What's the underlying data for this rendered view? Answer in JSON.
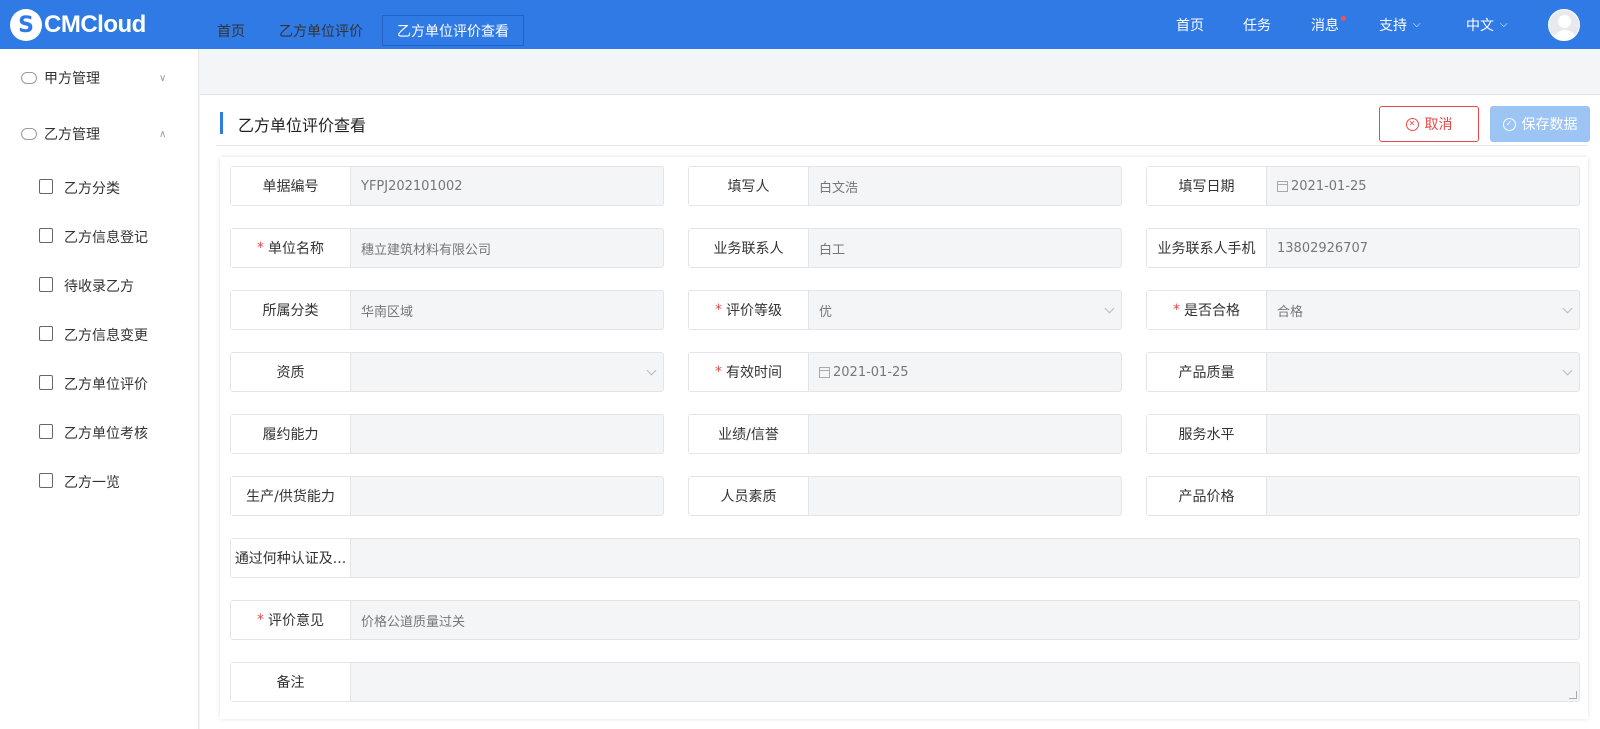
{
  "app": {
    "logo_mark": "S",
    "logo_text": "CMCloud"
  },
  "topnav": {
    "home": "首页",
    "tasks": "任务",
    "messages": "消息",
    "support": "支持",
    "language": "中文"
  },
  "sidebar": {
    "groups": [
      {
        "label": "甲方管理",
        "expanded": false
      },
      {
        "label": "乙方管理",
        "expanded": true
      }
    ],
    "items": [
      {
        "label": "乙方分类"
      },
      {
        "label": "乙方信息登记"
      },
      {
        "label": "待收录乙方"
      },
      {
        "label": "乙方信息变更"
      },
      {
        "label": "乙方单位评价"
      },
      {
        "label": "乙方单位考核"
      },
      {
        "label": "乙方一览"
      }
    ]
  },
  "tabs": [
    {
      "label": "首页",
      "active": false
    },
    {
      "label": "乙方单位评价",
      "active": false
    },
    {
      "label": "乙方单位评价查看",
      "active": true
    }
  ],
  "page": {
    "title": "乙方单位评价查看",
    "cancel_label": "取消",
    "save_label": "保存数据"
  },
  "form": {
    "doc_no": {
      "label": "单据编号",
      "value": "YFPJ202101002"
    },
    "filler": {
      "label": "填写人",
      "value": "白文浩"
    },
    "fill_date": {
      "label": "填写日期",
      "value": "2021-01-25"
    },
    "unit_name": {
      "label": "单位名称",
      "value": "穗立建筑材料有限公司",
      "required": true
    },
    "contact": {
      "label": "业务联系人",
      "value": "白工"
    },
    "contact_phone": {
      "label": "业务联系人手机",
      "value": "13802926707"
    },
    "category": {
      "label": "所属分类",
      "value": "华南区域"
    },
    "rating_level": {
      "label": "评价等级",
      "value": "优",
      "required": true
    },
    "qualified": {
      "label": "是否合格",
      "value": "合格",
      "required": true
    },
    "qualification": {
      "label": "资质",
      "value": ""
    },
    "valid_time": {
      "label": "有效时间",
      "value": "2021-01-25",
      "required": true
    },
    "product_quality": {
      "label": "产品质量",
      "value": ""
    },
    "performance": {
      "label": "履约能力",
      "value": ""
    },
    "credit": {
      "label": "业绩/信誉",
      "value": ""
    },
    "service": {
      "label": "服务水平",
      "value": ""
    },
    "supply": {
      "label": "生产/供货能力",
      "value": ""
    },
    "staff": {
      "label": "人员素质",
      "value": ""
    },
    "price": {
      "label": "产品价格",
      "value": ""
    },
    "certification": {
      "label": "通过何种认证及...",
      "value": ""
    },
    "opinion": {
      "label": "评价意见",
      "value": "价格公道质量过关",
      "required": true
    },
    "remark": {
      "label": "备注",
      "value": ""
    }
  },
  "colors": {
    "brand": "#2f7ae5",
    "danger": "#e64848",
    "disabled_button": "#9cc4f5"
  }
}
